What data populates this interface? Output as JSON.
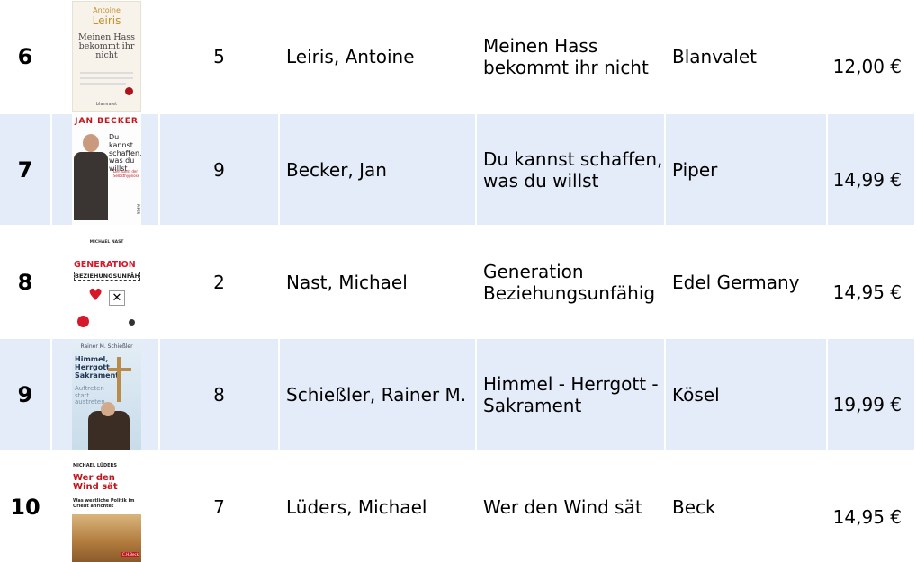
{
  "rows": [
    {
      "rank": "6",
      "previous": "5",
      "author": "Leiris, Antoine",
      "title": "Meinen Hass bekommt ihr nicht",
      "publisher": "Blanvalet",
      "price": "12,00 €",
      "cover": {
        "top": "Antoine",
        "name": "Leiris",
        "title": "Meinen Hass bekommt ihr nicht",
        "imprint": "blanvalet"
      }
    },
    {
      "rank": "7",
      "previous": "9",
      "author": "Becker, Jan",
      "title": "Du kannst schaffen, was du willst",
      "publisher": "Piper",
      "price": "14,99 €",
      "cover": {
        "name": "JAN BECKER",
        "title": "Du kannst schaffen, was du willst",
        "sub": "Die Kunst der Selbsthypnose",
        "imprint": "PIPER"
      }
    },
    {
      "rank": "8",
      "previous": "2",
      "author": "Nast, Michael",
      "title": "Generation Beziehungsunfähig",
      "publisher": "Edel Germany",
      "price": "14,95 €",
      "cover": {
        "name": "MICHAEL NAST",
        "title1": "GENERATION",
        "title2": "BEZIEHUNGSUNFÄHIG"
      }
    },
    {
      "rank": "9",
      "previous": "8",
      "author": "Schießler, Rainer M.",
      "title": "Himmel - Herrgott - Sakrament",
      "publisher": "Kösel",
      "price": "19,99 €",
      "cover": {
        "name": "Rainer M. Schießler",
        "title": "Himmel, Herrgott, Sakrament",
        "sub": "Auftreten statt austreten"
      }
    },
    {
      "rank": "10",
      "previous": "7",
      "author": "Lüders, Michael",
      "title": "Wer den Wind sät",
      "publisher": "Beck",
      "price": "14,95 €",
      "cover": {
        "name": "MICHAEL LÜDERS",
        "title": "Wer den Wind sät",
        "sub": "Was westliche Politik im Orient anrichtet",
        "imprint": "C.H.Beck"
      }
    }
  ]
}
